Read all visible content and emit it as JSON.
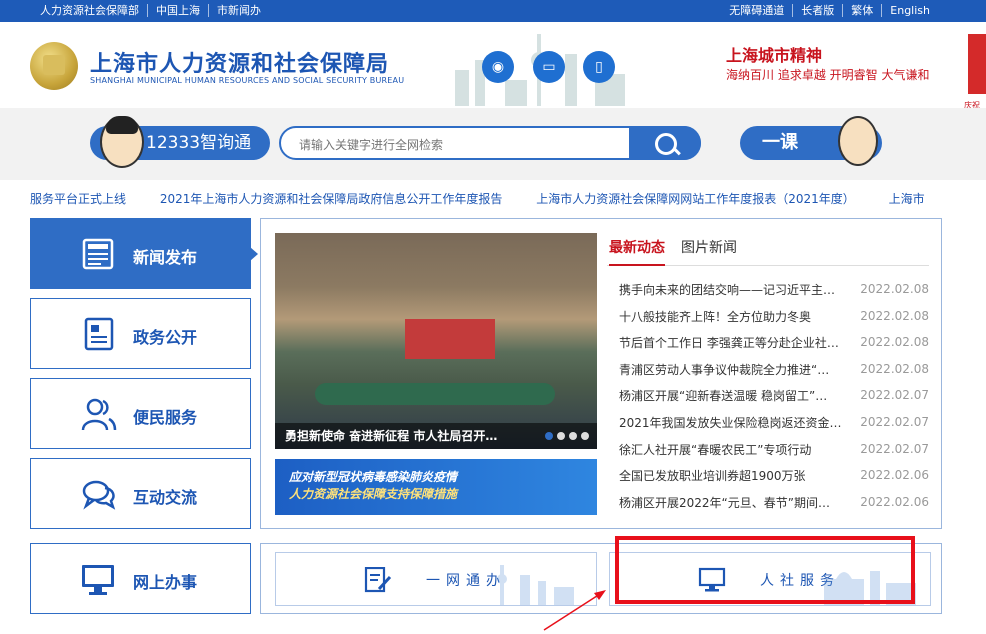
{
  "topbar": {
    "left_links": [
      "人力资源社会保障部",
      "中国上海",
      "市新闻办"
    ],
    "right_links": [
      "无障碍通道",
      "长者版",
      "繁体",
      "English"
    ]
  },
  "header": {
    "org_name_cn": "上海市人力资源和社会保障局",
    "org_name_en": "SHANGHAI MUNICIPAL HUMAN RESOURCES AND SOCIAL SECURITY BUREAU",
    "social_icons": [
      "weibo-icon",
      "monitor-icon",
      "mobile-icon"
    ],
    "spirit_title": "上海城市精神",
    "spirit_text": "海纳百川 追求卓越 开明睿智 大气谦和",
    "flag_text": "庆祝"
  },
  "search": {
    "assistant_label": "12333智询通",
    "placeholder": "请输入关键字进行全网检索",
    "course_label": "一课"
  },
  "ticker": [
    "服务平台正式上线",
    "2021年上海市人力资源和社会保障局政府信息公开工作年度报告",
    "上海市人力资源社会保障网网站工作年度报表（2021年度）",
    "上海市"
  ],
  "sidenav": [
    {
      "label": "新闻发布",
      "icon": "news-icon",
      "active": true
    },
    {
      "label": "政务公开",
      "icon": "document-icon",
      "active": false
    },
    {
      "label": "便民服务",
      "icon": "people-icon",
      "active": false
    },
    {
      "label": "互动交流",
      "icon": "chat-icon",
      "active": false
    }
  ],
  "online_service": {
    "label": "网上办事",
    "icon": "computer-icon"
  },
  "news": {
    "photo_caption": "勇担新使命 奋进新征程 市人社局召开…",
    "banner_line1": "应对新型冠状病毒感染肺炎疫情",
    "banner_line2": "人力资源社会保障支持保障措施",
    "tabs": [
      "最新动态",
      "图片新闻"
    ],
    "items": [
      {
        "title": "携手向未来的团结交响——记习近平主…",
        "date": "2022.02.08"
      },
      {
        "title": "十八般技能齐上阵！全方位助力冬奥",
        "date": "2022.02.08"
      },
      {
        "title": "节后首个工作日 李强龚正等分赴企业社…",
        "date": "2022.02.08"
      },
      {
        "title": "青浦区劳动人事争议仲裁院全力推进“…",
        "date": "2022.02.08"
      },
      {
        "title": "杨浦区开展“迎新春送温暖 稳岗留工”…",
        "date": "2022.02.07"
      },
      {
        "title": "2021年我国发放失业保险稳岗返还资金…",
        "date": "2022.02.07"
      },
      {
        "title": "徐汇人社开展“春暖农民工”专项行动",
        "date": "2022.02.07"
      },
      {
        "title": "全国已发放职业培训券超1900万张",
        "date": "2022.02.06"
      },
      {
        "title": "杨浦区开展2022年“元旦、春节”期间…",
        "date": "2022.02.06"
      }
    ]
  },
  "services": [
    {
      "label": "一网通办",
      "icon": "form-edit-icon"
    },
    {
      "label": "人社服务",
      "icon": "desktop-icon"
    }
  ],
  "colors": {
    "primary": "#2f6dc5",
    "accent_red": "#c8141e",
    "highlight": "#e8101a"
  }
}
